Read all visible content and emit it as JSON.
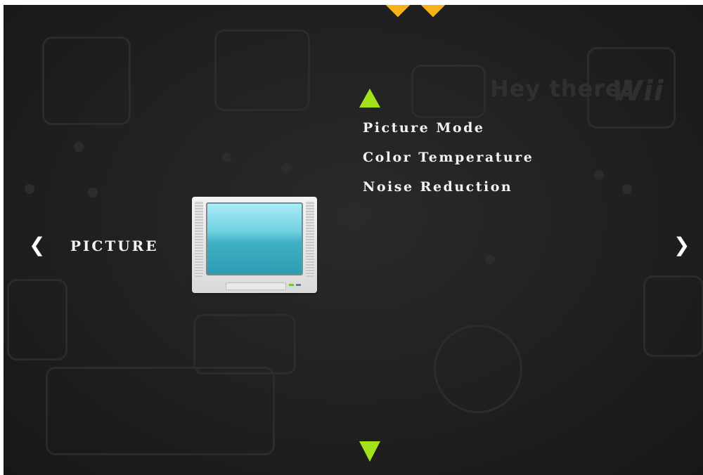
{
  "section": {
    "title": "PICTURE"
  },
  "menu": {
    "items": [
      {
        "label": "Picture Mode"
      },
      {
        "label": "Color Temperature"
      },
      {
        "label": "Noise Reduction"
      }
    ]
  },
  "navigation": {
    "left_glyph": "❮",
    "right_glyph": "❯"
  },
  "icons": {
    "up": "triangle-up-icon",
    "down": "triangle-down-icon",
    "section": "tv-icon"
  },
  "background_text": {
    "greeting": "Hey there!",
    "brand": "Wii"
  },
  "colors": {
    "accent_arrow": "#a3e21c",
    "text": "#f2f2f2",
    "background": "#1f1f1f",
    "top_mark": "#f5b21b"
  }
}
